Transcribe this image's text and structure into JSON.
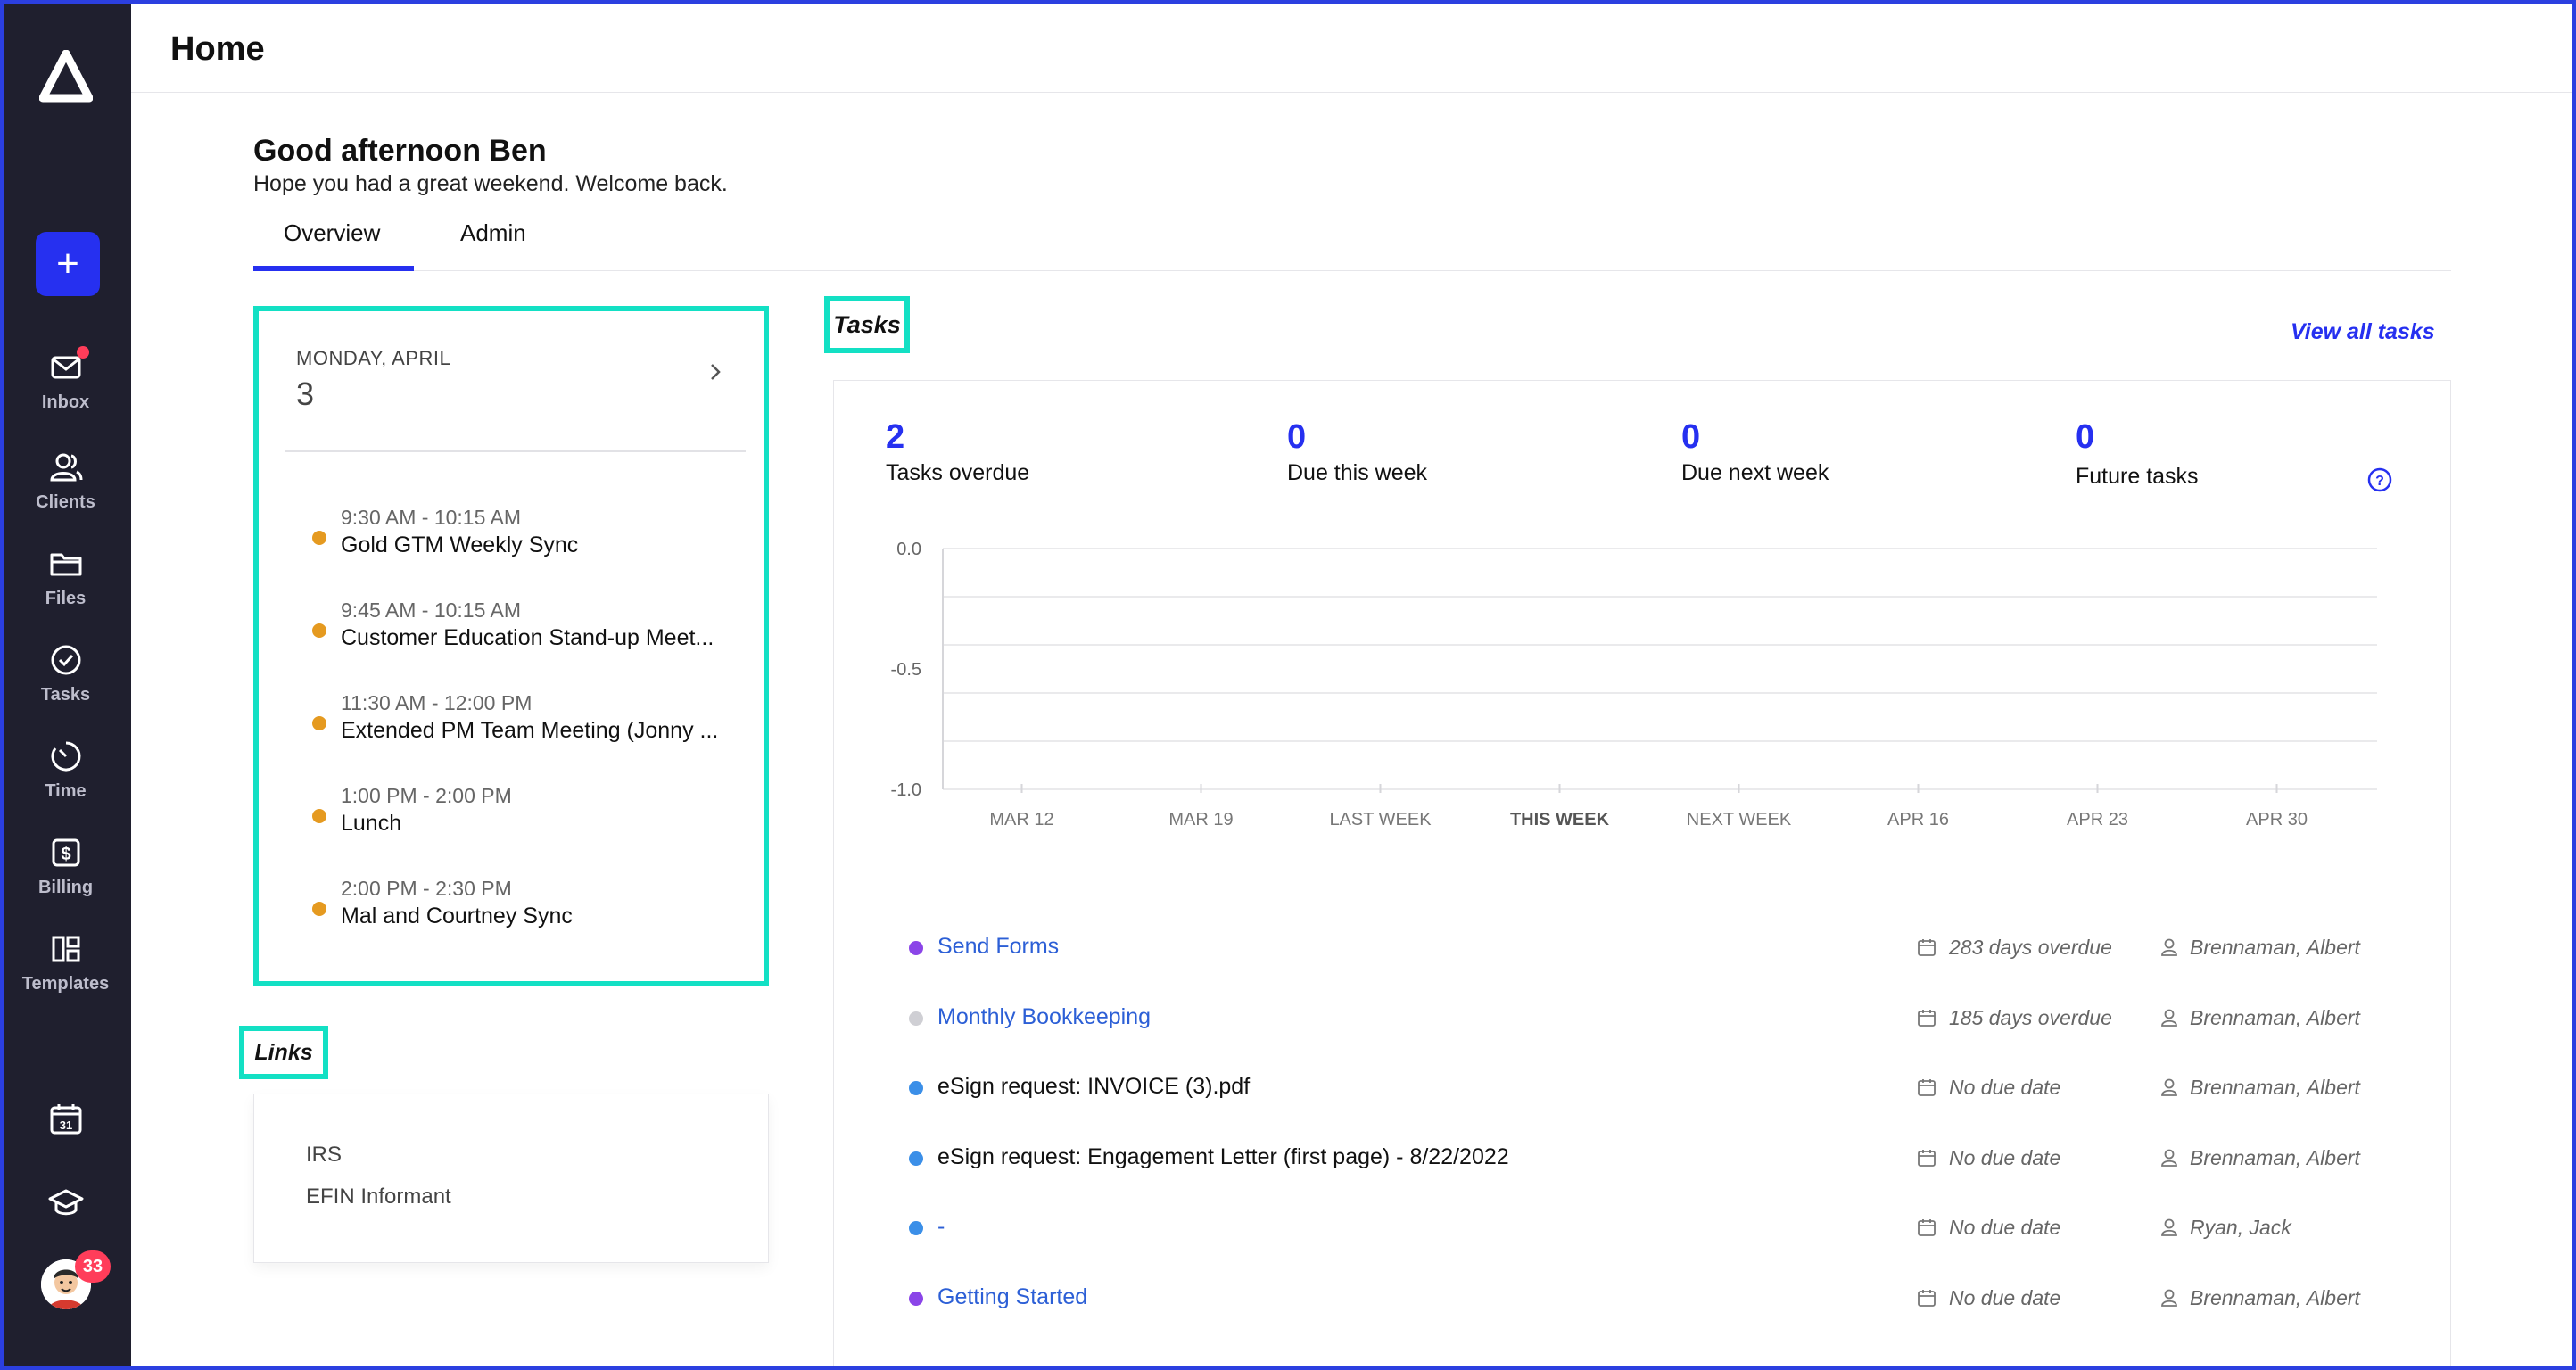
{
  "header": {
    "title": "Home"
  },
  "greeting": {
    "title": "Good afternoon Ben",
    "subtitle": "Hope you had a great weekend. Welcome back."
  },
  "tabs": [
    {
      "label": "Overview",
      "active": true
    },
    {
      "label": "Admin",
      "active": false
    }
  ],
  "sidebar": {
    "new_label": "+",
    "items": [
      {
        "label": "Inbox",
        "icon": "mail-icon",
        "notification": true
      },
      {
        "label": "Clients",
        "icon": "users-icon"
      },
      {
        "label": "Files",
        "icon": "folder-icon"
      },
      {
        "label": "Tasks",
        "icon": "check-circle-icon"
      },
      {
        "label": "Time",
        "icon": "clock-icon"
      },
      {
        "label": "Billing",
        "icon": "dollar-icon"
      },
      {
        "label": "Templates",
        "icon": "layout-icon"
      }
    ],
    "bottom": {
      "calendar_icon_text": "31",
      "badge_count": "33"
    }
  },
  "calendar": {
    "day_label": "MONDAY, APRIL",
    "day_number": "3",
    "events": [
      {
        "time": "9:30 AM - 10:15 AM",
        "title": "Gold GTM Weekly Sync"
      },
      {
        "time": "9:45 AM - 10:15 AM",
        "title": "Customer Education Stand-up Meet..."
      },
      {
        "time": "11:30 AM - 12:00 PM",
        "title": "Extended PM Team Meeting (Jonny ..."
      },
      {
        "time": "1:00 PM - 2:00 PM",
        "title": "Lunch"
      },
      {
        "time": "2:00 PM - 2:30 PM",
        "title": "Mal and Courtney Sync"
      }
    ],
    "event_color": "#e59a20"
  },
  "links": {
    "heading": "Links",
    "items": [
      "IRS",
      "EFIN Informant"
    ]
  },
  "tasks": {
    "heading": "Tasks",
    "view_all": "View all tasks",
    "stats": [
      {
        "value": "2",
        "label": "Tasks overdue"
      },
      {
        "value": "0",
        "label": "Due this week"
      },
      {
        "value": "0",
        "label": "Due next week"
      },
      {
        "value": "0",
        "label": "Future tasks"
      }
    ],
    "list": [
      {
        "name": "Send Forms",
        "link": true,
        "status_color": "#8b45e8",
        "due": "283 days overdue",
        "owner": "Brennaman, Albert"
      },
      {
        "name": "Monthly Bookkeeping",
        "link": true,
        "status_color": "#cfcfd4",
        "due": "185 days overdue",
        "owner": "Brennaman, Albert"
      },
      {
        "name": "eSign request: INVOICE (3).pdf",
        "link": false,
        "status_color": "#3b8fe8",
        "due": "No due date",
        "owner": "Brennaman, Albert"
      },
      {
        "name": "eSign request: Engagement Letter (first page) - 8/22/2022",
        "link": false,
        "status_color": "#3b8fe8",
        "due": "No due date",
        "owner": "Brennaman, Albert"
      },
      {
        "name": "-",
        "link": true,
        "status_color": "#3b8fe8",
        "due": "No due date",
        "owner": "Ryan, Jack"
      },
      {
        "name": "Getting Started",
        "link": true,
        "status_color": "#8b45e8",
        "due": "No due date",
        "owner": "Brennaman, Albert"
      }
    ]
  },
  "chart_data": {
    "type": "line",
    "categories": [
      "MAR 12",
      "MAR 19",
      "LAST WEEK",
      "THIS WEEK",
      "NEXT WEEK",
      "APR 16",
      "APR 23",
      "APR 30"
    ],
    "highlight_category": "THIS WEEK",
    "series": [],
    "ylim": [
      -1.0,
      0.0
    ],
    "y_ticks": [
      "0.0",
      "-0.5",
      "-1.0"
    ],
    "y_tick_values": [
      0.0,
      -0.5,
      -1.0
    ],
    "grid": true
  },
  "colors": {
    "accent": "#2630f0",
    "highlight_border": "#13e0c4",
    "sidebar_bg": "#1f1f2e",
    "badge": "#ff3d5a"
  }
}
